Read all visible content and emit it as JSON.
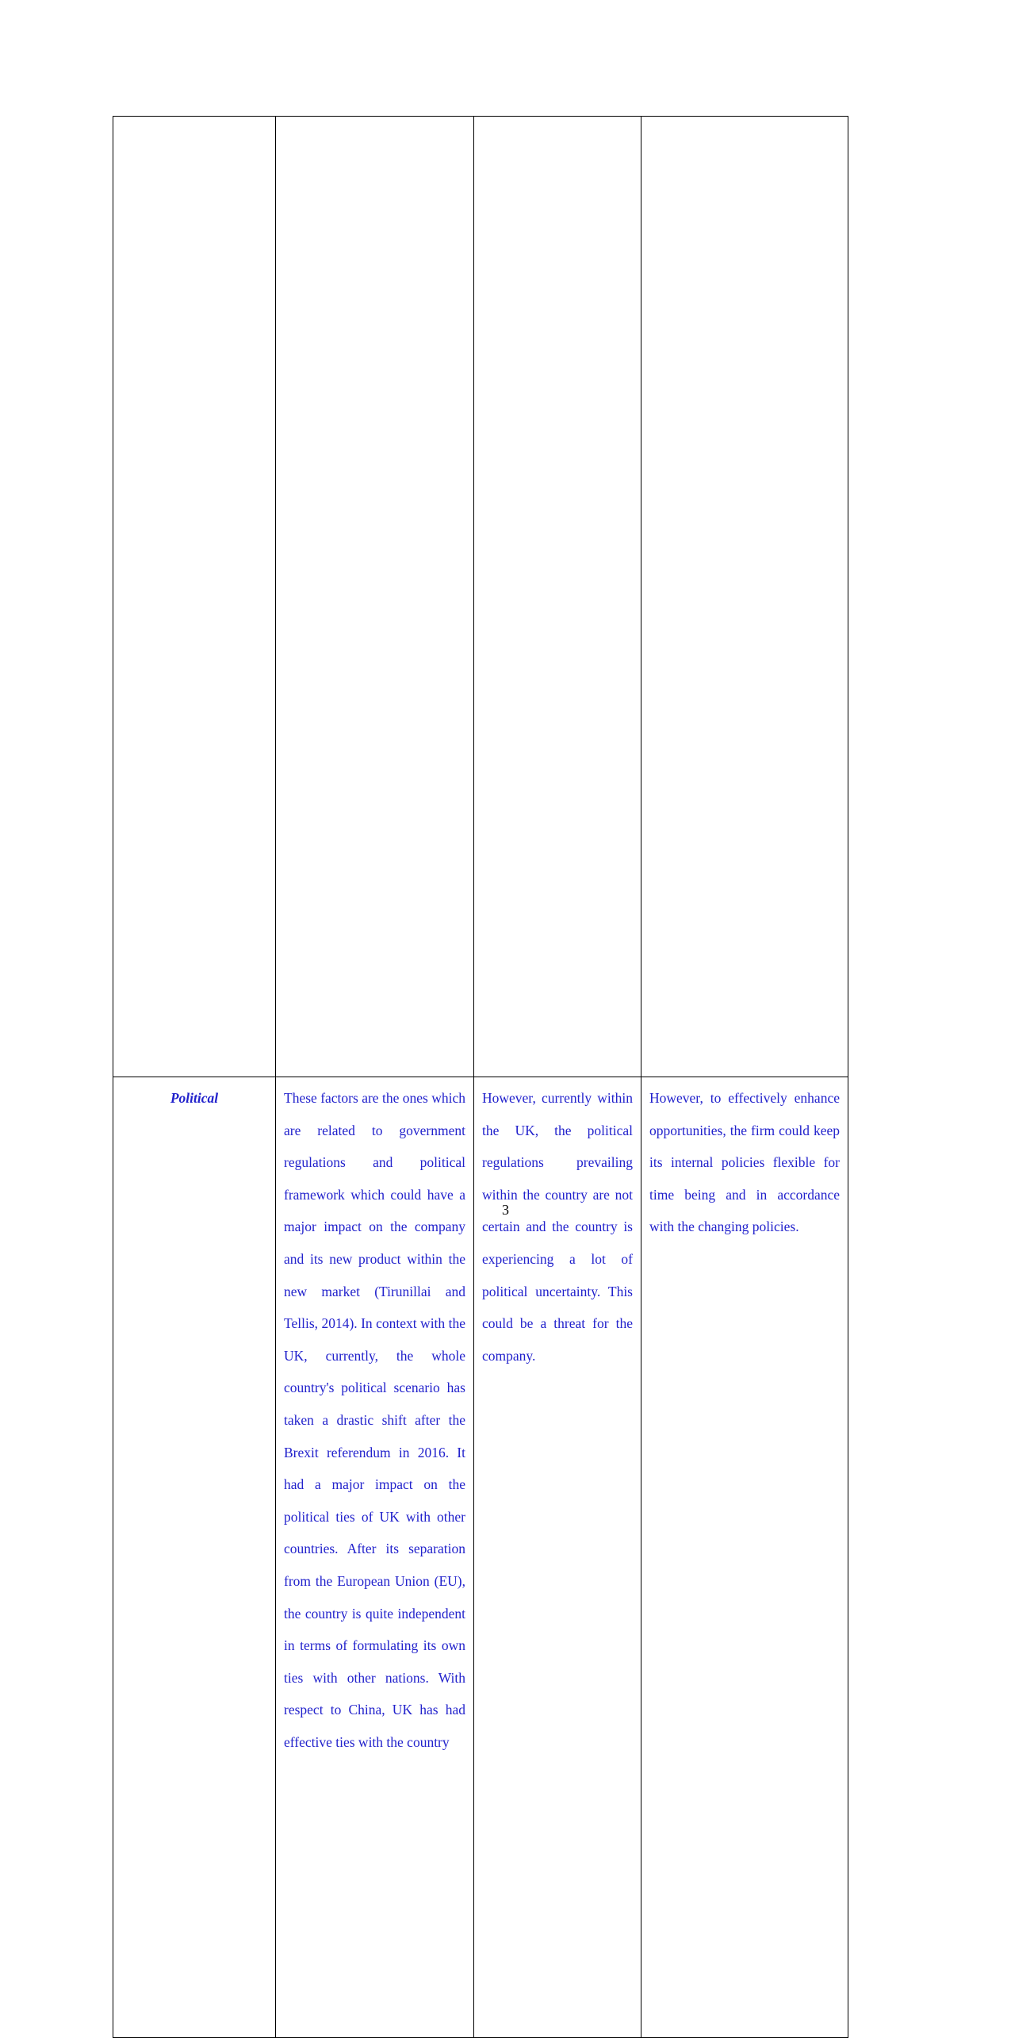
{
  "page": {
    "number": "3",
    "text_color": "#2222cc",
    "border_color": "#000000",
    "background": "#ffffff"
  },
  "table": {
    "name": "pestle-analysis-table",
    "columns": 4,
    "header_row": {
      "cells": [
        "",
        "",
        "",
        ""
      ]
    },
    "rows": [
      {
        "label": "Political",
        "description": "These factors are the ones which are related to government regulations and political framework which could have a major impact on the company and its new product within the new market (Tirunillai and Tellis, 2014). In context with the UK, currently, the whole country's political scenario has taken a drastic shift after the Brexit referendum in 2016. It had a major impact on the political ties of UK with other countries. After its separation from the European Union (EU), the country is quite independent in terms of formulating its own ties with other nations. With respect to China, UK has had effective ties with the country",
        "impact": "However, currently within the UK, the political regulations prevailing within the country are not certain and the country is experiencing a lot of political uncertainty. This could be a threat for the company.",
        "recommendation": "However, to effectively enhance opportunities, the firm could keep its internal policies flexible for time being and in accordance with the changing policies."
      }
    ]
  }
}
